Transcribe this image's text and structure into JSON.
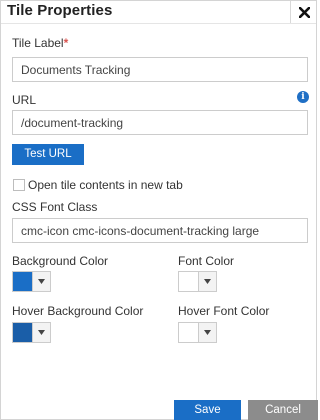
{
  "dialog": {
    "title": "Tile Properties",
    "close_icon": "close-icon"
  },
  "tile_label": {
    "label": "Tile Label",
    "required_marker": "*",
    "value": "Documents Tracking"
  },
  "url": {
    "label": "URL",
    "info_icon": "info-icon",
    "info_glyph": "i",
    "value": "/document-tracking",
    "test_button": "Test URL"
  },
  "new_tab": {
    "label": "Open tile contents in new tab",
    "checked": false
  },
  "css_font_class": {
    "label": "CSS Font Class",
    "value": "cmc-icon cmc-icons-document-tracking large"
  },
  "colors": {
    "background_color": {
      "label": "Background Color",
      "value": "#1a6ec6"
    },
    "font_color": {
      "label": "Font Color",
      "value": "#ffffff"
    },
    "hover_background_color": {
      "label": "Hover Background Color",
      "value": "#1a5ea8"
    },
    "hover_font_color": {
      "label": "Hover Font Color",
      "value": "#ffffff"
    }
  },
  "footer": {
    "save_label": "Save",
    "cancel_label": "Cancel"
  }
}
